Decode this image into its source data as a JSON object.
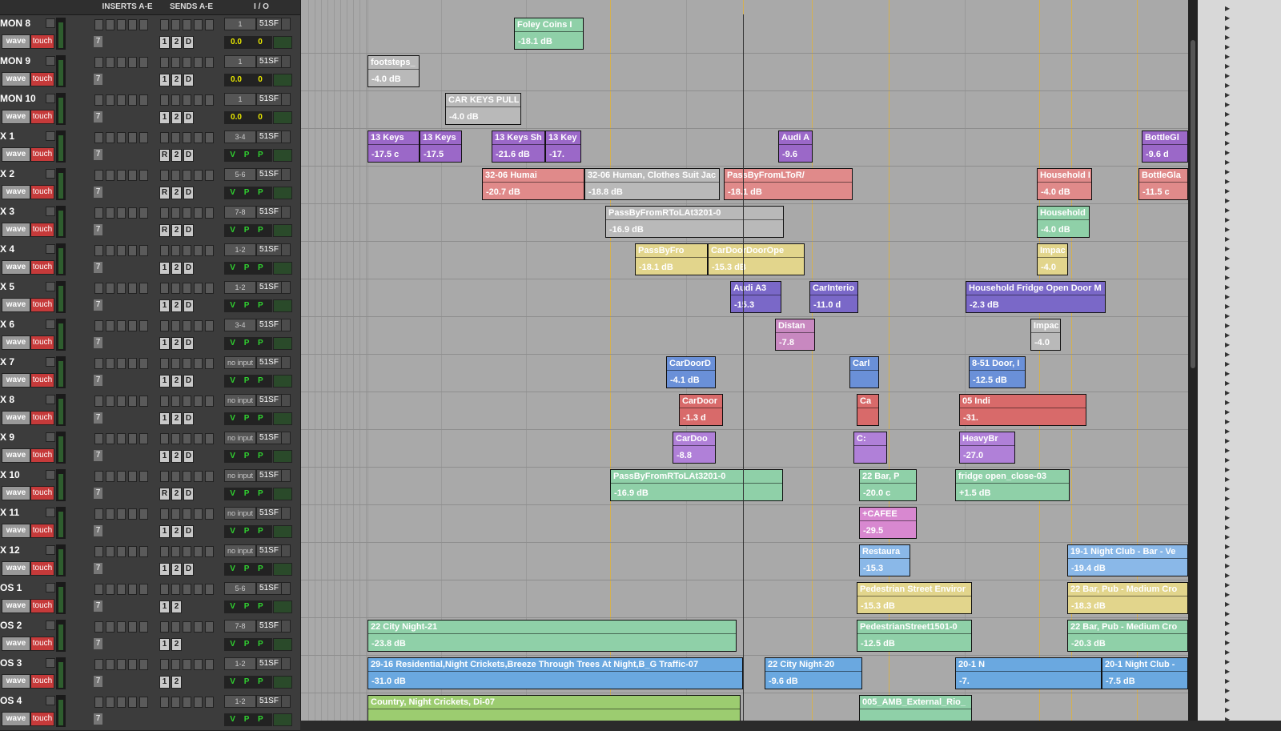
{
  "headers": {
    "inserts": "INSERTS A-E",
    "sends": "SENDS A-E",
    "io": "I / O"
  },
  "tracks": [
    {
      "name": "MON 8",
      "in": "1",
      "out": "51SF",
      "vol": "0.0",
      "pan": "0",
      "sends": [
        "1",
        "2",
        "D"
      ],
      "mode": "vol"
    },
    {
      "name": "MON 9",
      "in": "1",
      "out": "51SF",
      "vol": "0.0",
      "pan": "0",
      "sends": [
        "1",
        "2",
        "D"
      ],
      "mode": "vol"
    },
    {
      "name": "MON 10",
      "in": "1",
      "out": "51SF",
      "vol": "0.0",
      "pan": "0",
      "sends": [
        "1",
        "2",
        "D"
      ],
      "mode": "vol"
    },
    {
      "name": "X 1",
      "in": "3-4",
      "out": "51SF",
      "sends": [
        "R",
        "2",
        "D"
      ],
      "mode": "vpp"
    },
    {
      "name": "X 2",
      "in": "5-6",
      "out": "51SF",
      "sends": [
        "R",
        "2",
        "D"
      ],
      "mode": "vpp"
    },
    {
      "name": "X 3",
      "in": "7-8",
      "out": "51SF",
      "sends": [
        "R",
        "2",
        "D"
      ],
      "mode": "vpp"
    },
    {
      "name": "X 4",
      "in": "1-2",
      "out": "51SF",
      "sends": [
        "1",
        "2",
        "D"
      ],
      "mode": "vpp"
    },
    {
      "name": "X 5",
      "in": "1-2",
      "out": "51SF",
      "sends": [
        "1",
        "2",
        "D"
      ],
      "mode": "vpp"
    },
    {
      "name": "X 6",
      "in": "3-4",
      "out": "51SF",
      "sends": [
        "1",
        "2",
        "D"
      ],
      "mode": "vpp"
    },
    {
      "name": "X 7",
      "in": "no input",
      "out": "51SF",
      "sends": [
        "1",
        "2",
        "D"
      ],
      "mode": "vpp"
    },
    {
      "name": "X 8",
      "in": "no input",
      "out": "51SF",
      "sends": [
        "1",
        "2",
        "D"
      ],
      "mode": "vpp"
    },
    {
      "name": "X 9",
      "in": "no input",
      "out": "51SF",
      "sends": [
        "1",
        "2",
        "D"
      ],
      "mode": "vpp"
    },
    {
      "name": "X 10",
      "in": "no input",
      "out": "51SF",
      "sends": [
        "R",
        "2",
        "D"
      ],
      "mode": "vpp"
    },
    {
      "name": "X 11",
      "in": "no input",
      "out": "51SF",
      "sends": [
        "1",
        "2",
        "D"
      ],
      "mode": "vpp"
    },
    {
      "name": "X 12",
      "in": "no input",
      "out": "51SF",
      "sends": [
        "1",
        "2",
        "D"
      ],
      "mode": "vpp"
    },
    {
      "name": "OS 1",
      "in": "5-6",
      "out": "51SF",
      "sends": [
        "1",
        "2"
      ],
      "mode": "vpp"
    },
    {
      "name": "OS 2",
      "in": "7-8",
      "out": "51SF",
      "sends": [
        "1",
        "2"
      ],
      "mode": "vpp"
    },
    {
      "name": "OS 3",
      "in": "1-2",
      "out": "51SF",
      "sends": [
        "1",
        "2"
      ],
      "mode": "vpp"
    },
    {
      "name": "OS 4",
      "in": "1-2",
      "out": "51SF",
      "sends": [],
      "mode": "vpp"
    }
  ],
  "labels": {
    "wave": "wave",
    "touch": "touch",
    "vpp": "V P P",
    "number": "7"
  },
  "clips": [
    {
      "row": 0,
      "start": 642,
      "end": 729,
      "name": "Foley Coins I",
      "gain": "-18.1 dB",
      "color": "#8fd0a8"
    },
    {
      "row": 1,
      "start": 459,
      "end": 524,
      "name": "footsteps_",
      "gain": "-4.0 dB",
      "color": "#b9b9b9"
    },
    {
      "row": 2,
      "start": 556,
      "end": 651,
      "name": "CAR KEYS PULL",
      "gain": "-4.0 dB",
      "color": "#b9b9b9"
    },
    {
      "row": 3,
      "start": 459,
      "end": 524,
      "name": "13 Keys",
      "gain": "-17.5 c",
      "color": "#9b68c8"
    },
    {
      "row": 3,
      "start": 524,
      "end": 577,
      "name": "13 Keys",
      "gain": "-17.5",
      "color": "#9b68c8"
    },
    {
      "row": 3,
      "start": 614,
      "end": 681,
      "name": "13 Keys Sh",
      "gain": "-21.6 dB",
      "color": "#9b68c8"
    },
    {
      "row": 3,
      "start": 681,
      "end": 726,
      "name": "13 Key",
      "gain": "-17.",
      "color": "#9b68c8"
    },
    {
      "row": 3,
      "start": 972,
      "end": 1015,
      "name": "Audi A",
      "gain": "-9.6",
      "color": "#9b68c8"
    },
    {
      "row": 3,
      "start": 1426,
      "end": 1484,
      "name": "BottleGl",
      "gain": "-9.6 d",
      "color": "#9b68c8"
    },
    {
      "row": 4,
      "start": 602,
      "end": 730,
      "name": "32-06 Humai",
      "gain": "-20.7 dB",
      "color": "#e08a8a"
    },
    {
      "row": 4,
      "start": 730,
      "end": 899,
      "name": "32-06 Human, Clothes Suit Jac",
      "gain": "-18.8 dB",
      "color": "#b9b9b9"
    },
    {
      "row": 4,
      "start": 904,
      "end": 1065,
      "name": "PassByFromLToR/",
      "gain": "-18.1 dB",
      "color": "#e08a8a"
    },
    {
      "row": 4,
      "start": 1295,
      "end": 1364,
      "name": "Household I",
      "gain": "-4.0 dB",
      "color": "#e08a8a"
    },
    {
      "row": 4,
      "start": 1422,
      "end": 1484,
      "name": "BottleGla",
      "gain": "-11.5 c",
      "color": "#e08a8a"
    },
    {
      "row": 5,
      "start": 756,
      "end": 979,
      "name": "PassByFromRToLAt3201-0",
      "gain": "-16.9 dB",
      "color": "#b9b9b9"
    },
    {
      "row": 5,
      "start": 1295,
      "end": 1361,
      "name": "Household",
      "gain": "-4.0 dB",
      "color": "#8fd0a8"
    },
    {
      "row": 6,
      "start": 793,
      "end": 884,
      "name": "PassByFro",
      "gain": "-18.1 dB",
      "color": "#e2d58c"
    },
    {
      "row": 6,
      "start": 884,
      "end": 1005,
      "name": "CarDoorDoorOpe",
      "gain": "-15.3 dB",
      "color": "#e2d58c"
    },
    {
      "row": 6,
      "start": 1295,
      "end": 1334,
      "name": "Impac",
      "gain": "-4.0",
      "color": "#e2d58c"
    },
    {
      "row": 7,
      "start": 912,
      "end": 976,
      "name": "Audi A3",
      "gain": "-15.3",
      "color": "#7a68c8"
    },
    {
      "row": 7,
      "start": 1011,
      "end": 1072,
      "name": "CarInterio",
      "gain": "-11.0 d",
      "color": "#7a68c8"
    },
    {
      "row": 7,
      "start": 1206,
      "end": 1381,
      "name": "Household Fridge Open Door M",
      "gain": "-2.3 dB",
      "color": "#7a68c8"
    },
    {
      "row": 8,
      "start": 968,
      "end": 1018,
      "name": "Distan",
      "gain": "-7.8",
      "color": "#c888c0"
    },
    {
      "row": 8,
      "start": 1287,
      "end": 1325,
      "name": "Impac",
      "gain": "-4.0",
      "color": "#b9b9b9"
    },
    {
      "row": 9,
      "start": 832,
      "end": 894,
      "name": "CarDoorD",
      "gain": "-4.1 dB",
      "color": "#6a90d8"
    },
    {
      "row": 9,
      "start": 1061,
      "end": 1098,
      "name": "Carl",
      "gain": "",
      "color": "#6a90d8"
    },
    {
      "row": 9,
      "start": 1210,
      "end": 1281,
      "name": "8-51 Door, I",
      "gain": "-12.5 dB",
      "color": "#6a90d8"
    },
    {
      "row": 10,
      "start": 848,
      "end": 903,
      "name": "CarDoor",
      "gain": "-1.3 d",
      "color": "#d86a6a"
    },
    {
      "row": 10,
      "start": 1070,
      "end": 1098,
      "name": "Ca",
      "gain": "",
      "color": "#d86a6a"
    },
    {
      "row": 10,
      "start": 1198,
      "end": 1357,
      "name": "05 Indi",
      "gain": "-31.",
      "color": "#d86a6a"
    },
    {
      "row": 11,
      "start": 840,
      "end": 894,
      "name": "CarDoo",
      "gain": "-8.8",
      "color": "#b080d8"
    },
    {
      "row": 11,
      "start": 1066,
      "end": 1108,
      "name": "C:",
      "gain": "",
      "color": "#b080d8"
    },
    {
      "row": 11,
      "start": 1198,
      "end": 1268,
      "name": "HeavyBr",
      "gain": "-27.0",
      "color": "#b080d8"
    },
    {
      "row": 12,
      "start": 762,
      "end": 978,
      "name": "PassByFromRToLAt3201-0",
      "gain": "-16.9 dB",
      "color": "#8fd0a8"
    },
    {
      "row": 12,
      "start": 1073,
      "end": 1145,
      "name": "22 Bar, P",
      "gain": "-20.0 c",
      "color": "#8fd0a8"
    },
    {
      "row": 12,
      "start": 1193,
      "end": 1336,
      "name": "fridge open_close-03",
      "gain": "+1.5 dB",
      "color": "#8fd0a8"
    },
    {
      "row": 13,
      "start": 1073,
      "end": 1145,
      "name": "+CAFEE",
      "gain": "-29.5",
      "color": "#d888d0"
    },
    {
      "row": 14,
      "start": 1073,
      "end": 1137,
      "name": "Restaura",
      "gain": "-15.3",
      "color": "#8ab8e8"
    },
    {
      "row": 14,
      "start": 1333,
      "end": 1484,
      "name": "19-1 Night Club - Bar - Ve",
      "gain": "-19.4 dB",
      "color": "#8ab8e8"
    },
    {
      "row": 15,
      "start": 1070,
      "end": 1214,
      "name": "Pedestrian Street Enviror",
      "gain": "-15.3 dB",
      "color": "#e2d58c"
    },
    {
      "row": 15,
      "start": 1333,
      "end": 1484,
      "name": "22 Bar, Pub - Medium Cro",
      "gain": "-18.3 dB",
      "color": "#e2d58c"
    },
    {
      "row": 16,
      "start": 459,
      "end": 920,
      "name": "22 City Night-21",
      "gain": "-23.8 dB",
      "color": "#8fd0a8"
    },
    {
      "row": 16,
      "start": 1070,
      "end": 1214,
      "name": "PedestrianStreet1501-0",
      "gain": "-12.5 dB",
      "color": "#8fd0a8"
    },
    {
      "row": 16,
      "start": 1333,
      "end": 1484,
      "name": "22 Bar, Pub - Medium Cro",
      "gain": "-20.3 dB",
      "color": "#8fd0a8"
    },
    {
      "row": 17,
      "start": 459,
      "end": 928,
      "name": "29-16 Residential,Night Crickets,Breeze Through Trees At Night,B_G Traffic-07",
      "gain": "-31.0 dB",
      "color": "#6aa8e0"
    },
    {
      "row": 17,
      "start": 955,
      "end": 1077,
      "name": "22 City Night-20",
      "gain": "-9.6 dB",
      "color": "#6aa8e0"
    },
    {
      "row": 17,
      "start": 1193,
      "end": 1376,
      "name": "20-1 N",
      "gain": "-7.",
      "color": "#6aa8e0"
    },
    {
      "row": 17,
      "start": 1376,
      "end": 1484,
      "name": "20-1 Night Club -",
      "gain": "-7.5 dB",
      "color": "#6aa8e0"
    },
    {
      "row": 18,
      "start": 459,
      "end": 925,
      "name": "Country, Night Crickets, Di-07",
      "gain": "",
      "color": "#9ccc70"
    },
    {
      "row": 18,
      "start": 1073,
      "end": 1214,
      "name": "005_AMB_External_Rio_",
      "gain": "",
      "color": "#8fd0a8"
    }
  ]
}
